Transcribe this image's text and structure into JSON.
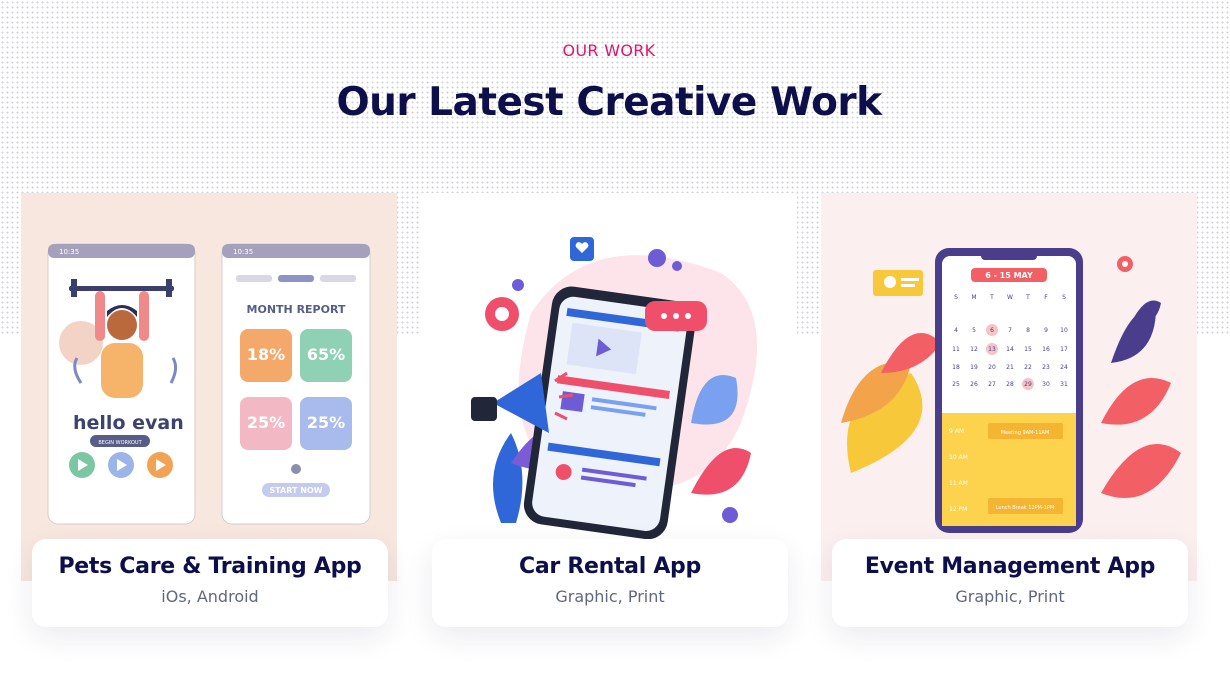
{
  "section": {
    "eyebrow": "OUR WORK",
    "title": "Our Latest Creative Work"
  },
  "projects": [
    {
      "title": "Pets Care & Training App",
      "tags": "iOs, Android",
      "illustration": "fitness-app-screens",
      "phone_text": {
        "time_left": "10:35",
        "time_right": "10:35",
        "greeting": "hello evan",
        "button": "BEGIN WORKOUT",
        "report_title": "MONTH REPORT",
        "stat_1": "18%",
        "stat_2": "65%",
        "stat_3": "25%",
        "stat_4": "25%",
        "cta": "START NOW"
      }
    },
    {
      "title": "Car Rental App",
      "tags": "Graphic, Print",
      "illustration": "phone-marketing-megaphone"
    },
    {
      "title": "Event Management App",
      "tags": "Graphic, Print",
      "illustration": "calendar-phone",
      "calendar_text": {
        "month": "6 - 15 MAY",
        "weekdays": [
          "S",
          "M",
          "T",
          "W",
          "T",
          "F",
          "S"
        ],
        "days": [
          "4",
          "5",
          "6",
          "7",
          "8",
          "9",
          "10",
          "11",
          "12",
          "13",
          "14",
          "15",
          "16",
          "17",
          "18",
          "19",
          "20",
          "21",
          "22",
          "23",
          "24",
          "25",
          "26",
          "27",
          "28",
          "29",
          "30",
          "31"
        ],
        "slot_1_time": "9 AM",
        "slot_1_event": "Meeting 9AM-11AM",
        "slot_2_time": "10 AM",
        "slot_3_time": "11 AM",
        "slot_4_time": "12 PM",
        "slot_4_event": "Lunch Break 12PM-1PM"
      }
    }
  ],
  "colors": {
    "accent": "#e0156b",
    "heading": "#0e0e4a",
    "muted": "#626780"
  }
}
